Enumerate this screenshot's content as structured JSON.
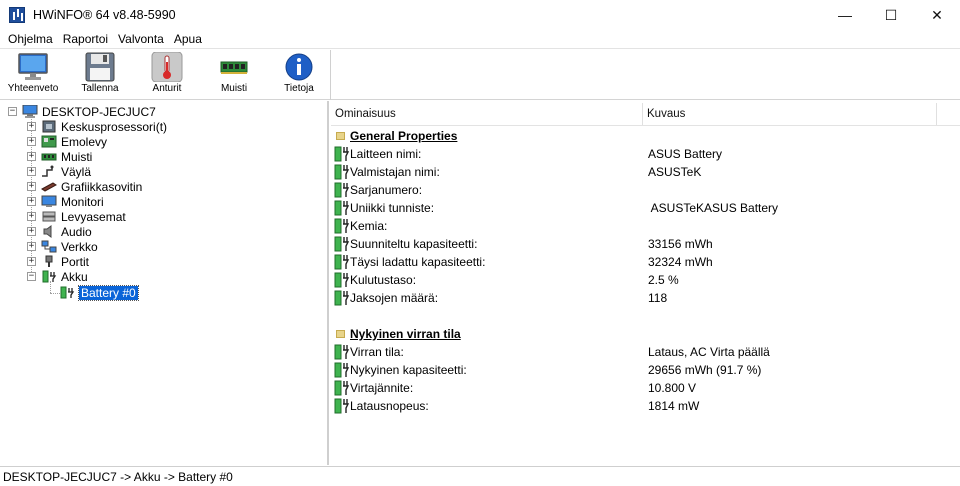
{
  "window": {
    "title": "HWiNFO® 64 v8.48-5990",
    "minimize": "—",
    "maximize": "☐",
    "close": "✕"
  },
  "menu": [
    "Ohjelma",
    "Raportoi",
    "Valvonta",
    "Apua"
  ],
  "toolbar": [
    {
      "label": "Yhteenveto",
      "icon": "monitor-icon"
    },
    {
      "label": "Tallenna",
      "icon": "floppy-disk-icon"
    },
    {
      "label": "Anturit",
      "icon": "thermometer-icon"
    },
    {
      "label": "Muisti",
      "icon": "memory-module-icon"
    },
    {
      "label": "Tietoja",
      "icon": "info-icon"
    }
  ],
  "tree": {
    "root": "DESKTOP-JECJUC7",
    "items": [
      {
        "label": "Keskusprosessori(t)",
        "icon": "cpu-icon"
      },
      {
        "label": "Emolevy",
        "icon": "motherboard-icon"
      },
      {
        "label": "Muisti",
        "icon": "memory-icon"
      },
      {
        "label": "Väylä",
        "icon": "bus-icon"
      },
      {
        "label": "Grafiikkasovitin",
        "icon": "gpu-icon"
      },
      {
        "label": "Monitori",
        "icon": "monitor-icon"
      },
      {
        "label": "Levyasemat",
        "icon": "drive-icon"
      },
      {
        "label": "Audio",
        "icon": "speaker-icon"
      },
      {
        "label": "Verkko",
        "icon": "network-icon"
      },
      {
        "label": "Portit",
        "icon": "port-icon"
      },
      {
        "label": "Akku",
        "icon": "battery-icon"
      }
    ],
    "child": "Battery #0"
  },
  "columns": {
    "property": "Ominaisuus",
    "description": "Kuvaus"
  },
  "sections": [
    {
      "title": "General Properties",
      "rows": [
        {
          "name": "Laitteen nimi:",
          "value": "ASUS Battery"
        },
        {
          "name": "Valmistajan nimi:",
          "value": "ASUSTeK"
        },
        {
          "name": "Sarjanumero:",
          "value": ""
        },
        {
          "name": "Uniikki tunniste:",
          "value": " ASUSTeKASUS Battery"
        },
        {
          "name": "Kemia:",
          "value": ""
        },
        {
          "name": "Suunniteltu kapasiteetti:",
          "value": "33156 mWh"
        },
        {
          "name": "Täysi ladattu kapasiteetti:",
          "value": "32324 mWh"
        },
        {
          "name": "Kulutustaso:",
          "value": "2.5 %"
        },
        {
          "name": "Jaksojen määrä:",
          "value": "118"
        }
      ]
    },
    {
      "title": "Nykyinen virran tila",
      "rows": [
        {
          "name": "Virran tila:",
          "value": "Lataus, AC Virta päällä"
        },
        {
          "name": "Nykyinen kapasiteetti:",
          "value": "29656 mWh (91.7 %)"
        },
        {
          "name": "Virtajännite:",
          "value": "10.800 V"
        },
        {
          "name": "Latausnopeus:",
          "value": "1814 mW"
        }
      ]
    }
  ],
  "status": "DESKTOP-JECJUC7 -> Akku -> Battery #0",
  "colors": {
    "selection": "#0a64d8",
    "battery_green": "#3fb34f"
  }
}
